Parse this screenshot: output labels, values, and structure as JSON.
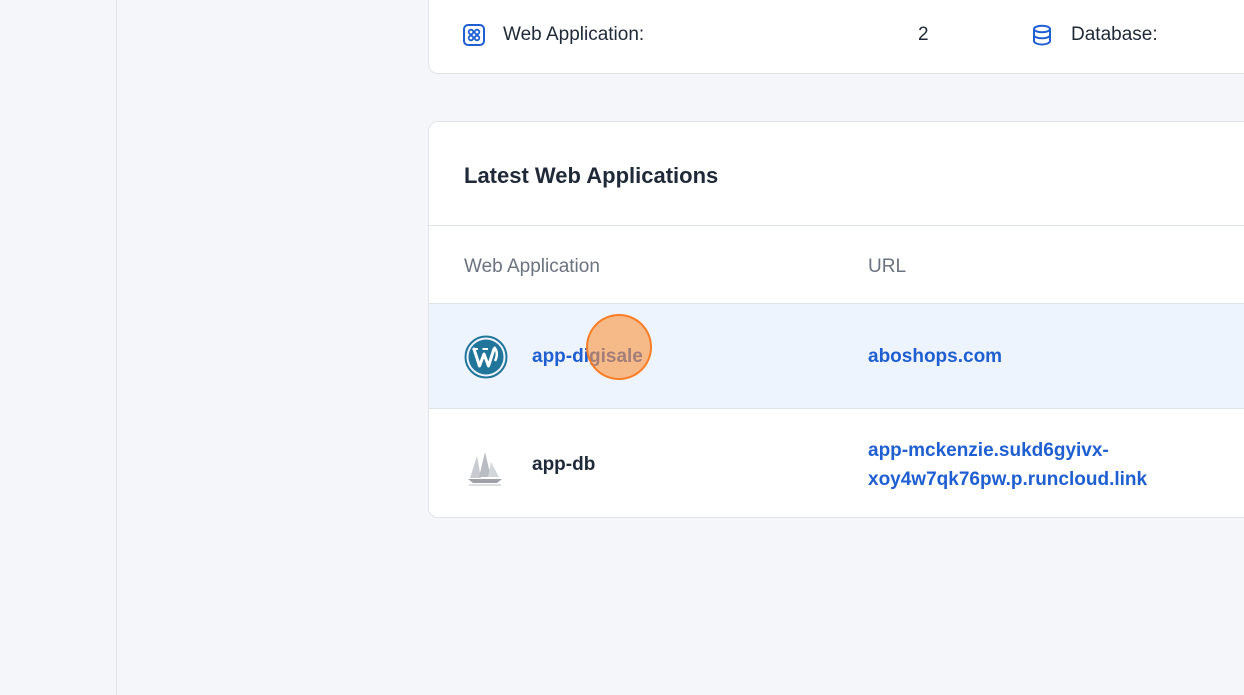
{
  "stats": {
    "web_application_label": "Web Application:",
    "web_application_count": "2",
    "database_label": "Database:"
  },
  "latest": {
    "title": "Latest Web Applications",
    "columns": [
      "Web Application",
      "URL"
    ],
    "rows": [
      {
        "name": "app-digisale",
        "url": "aboshops.com",
        "icon": "wordpress-icon"
      },
      {
        "name": "app-db",
        "url_line1": "app-mckenzie.sukd6gyivx-",
        "url_line2": "xoy4w7qk76pw.p.runcloud.link",
        "icon": "sailboat-icon"
      }
    ]
  },
  "colors": {
    "accent": "#1f5fd1",
    "row_highlight": "#eef4fd",
    "background": "#f4f6fa"
  }
}
